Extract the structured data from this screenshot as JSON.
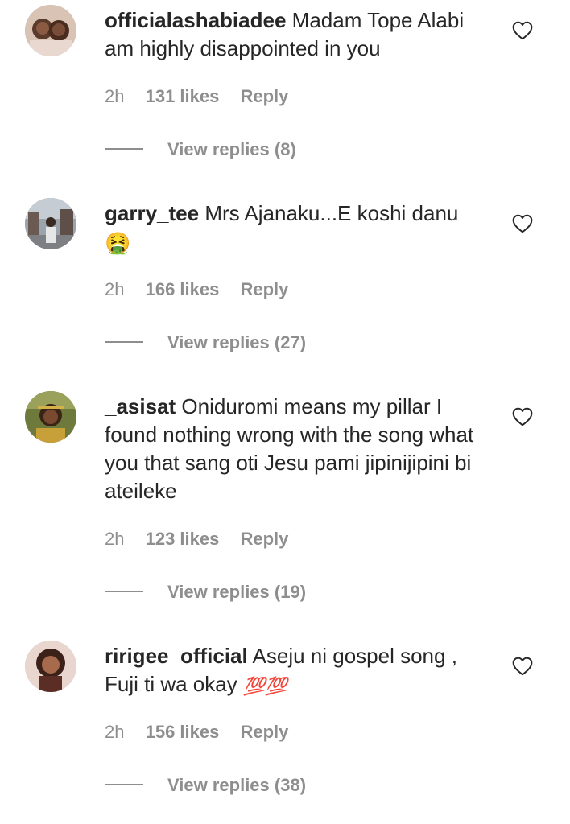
{
  "comments": [
    {
      "username": "officialashabiadee",
      "text": "Madam Tope Alabi am highly disappointed in you",
      "emoji": "",
      "time": "2h",
      "likes": "131 likes",
      "reply_label": "Reply",
      "view_replies": "View replies (8)"
    },
    {
      "username": "garry_tee",
      "text": "Mrs Ajanaku...E koshi danu",
      "emoji": "🤮",
      "time": "2h",
      "likes": "166 likes",
      "reply_label": "Reply",
      "view_replies": "View replies (27)"
    },
    {
      "username": "_asisat",
      "text": "Oniduromi means my pillar I found nothing wrong with the song what you that sang oti Jesu pami jipinijipini bi ateileke",
      "emoji": "",
      "time": "2h",
      "likes": "123 likes",
      "reply_label": "Reply",
      "view_replies": "View replies (19)"
    },
    {
      "username": "ririgee_official",
      "text": "Aseju ni gospel song , Fuji ti wa okay",
      "emoji": "💯💯",
      "time": "2h",
      "likes": "156 likes",
      "reply_label": "Reply",
      "view_replies": "View replies (38)"
    }
  ],
  "colors": {
    "text": "#262626",
    "secondary": "#8e8e8e"
  },
  "icons": {
    "like": "heart-outline-icon"
  }
}
